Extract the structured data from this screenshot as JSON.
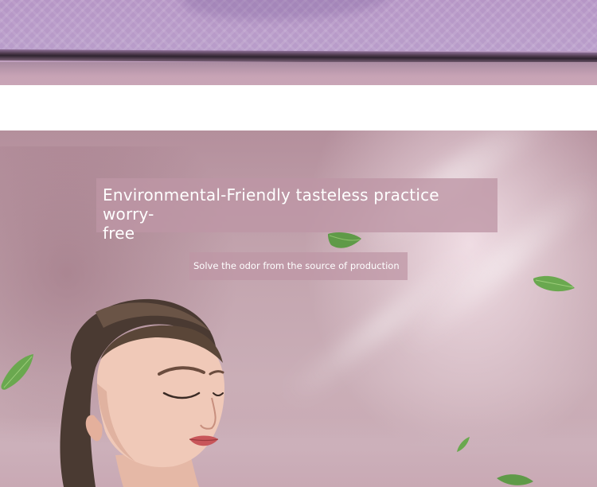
{
  "headline": {
    "line1": "Environmental-Friendly tasteless practice worry-",
    "line2": "free"
  },
  "subheadline": "Solve the odor from the source of production",
  "colors": {
    "mat": "#b696c6",
    "mat_edge": "#2f2430",
    "hero_background": "#c3a4ae",
    "caption_box": "#be96a5",
    "leaf": "#6fa854",
    "text": "#ffffff"
  },
  "icons": [
    "leaf-icon"
  ]
}
